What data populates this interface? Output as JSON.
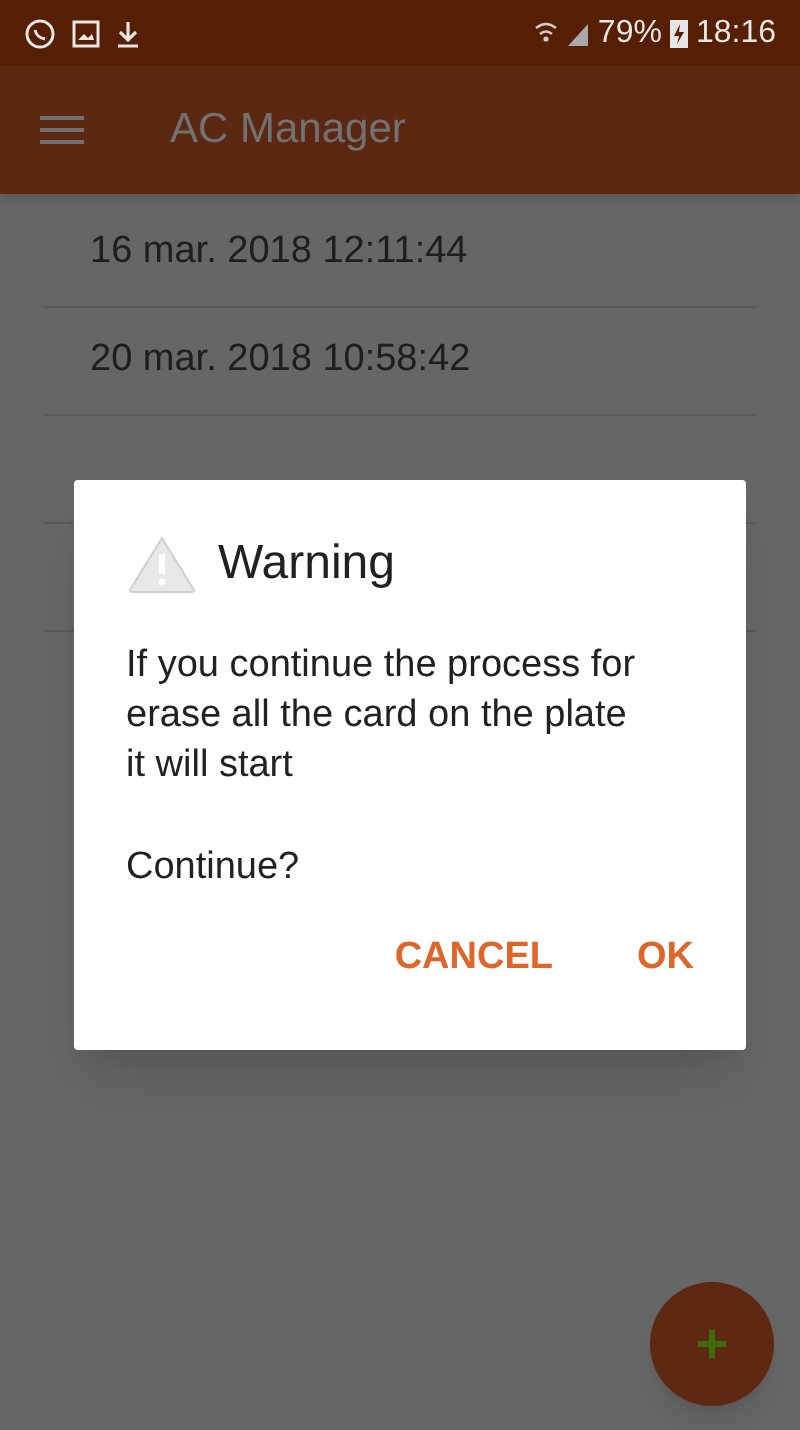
{
  "status_bar": {
    "battery": "79%",
    "time": "18:16"
  },
  "app_bar": {
    "title": "AC Manager"
  },
  "list": [
    {
      "label": "16 mar. 2018 12:11:44"
    },
    {
      "label": "20 mar. 2018 10:58:42"
    }
  ],
  "dialog": {
    "title": "Warning",
    "message": "If you continue the process for erase all the card on the plate it will start",
    "question": "Continue?",
    "buttons": [
      "CANCEL",
      "OK"
    ]
  }
}
